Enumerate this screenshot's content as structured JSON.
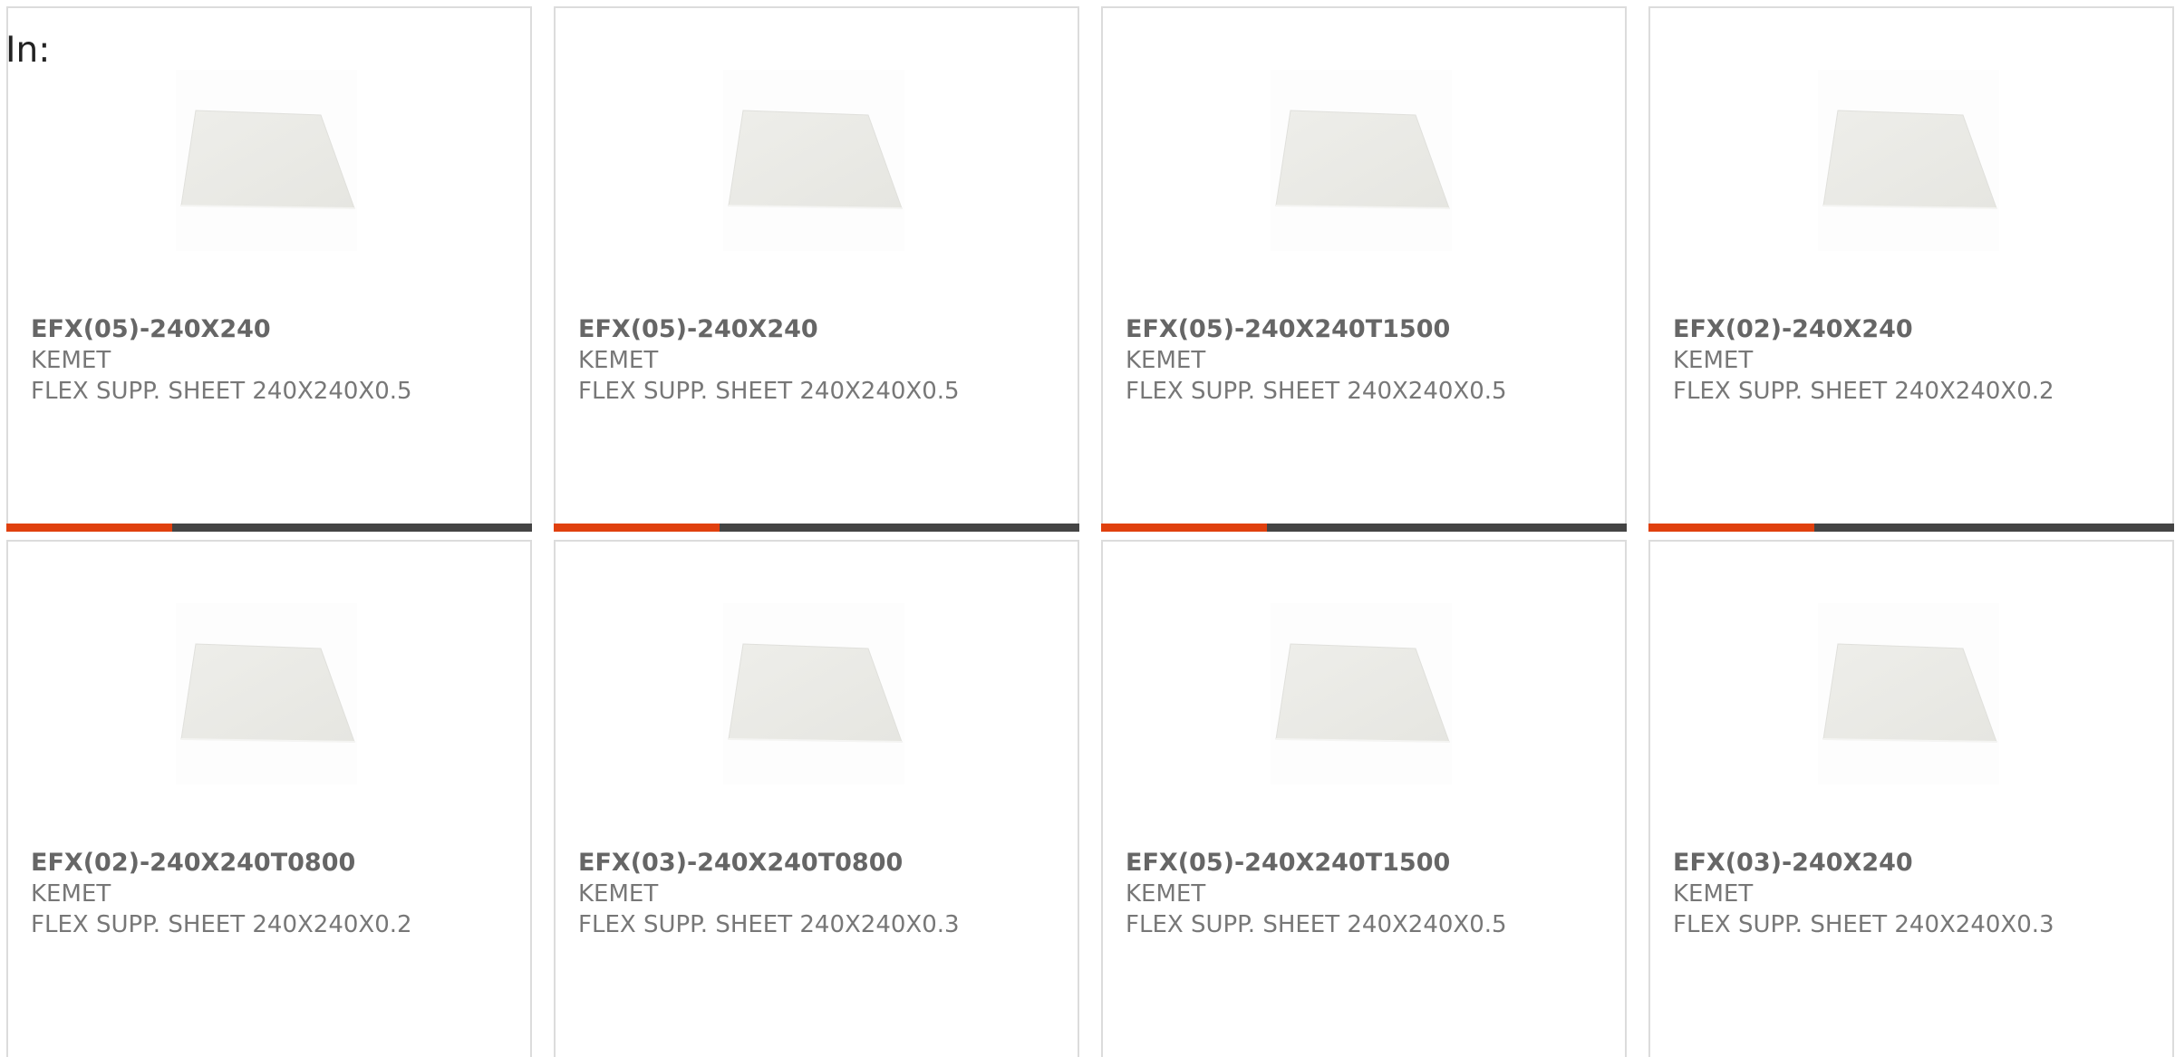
{
  "prefix_label": "In:",
  "colors": {
    "accent": "#e0400e",
    "bar_dark": "#444444",
    "card_border": "#dcdcdc",
    "text_primary": "#666666",
    "text_secondary": "#777777"
  },
  "products": [
    {
      "part_number": "EFX(05)-240X240",
      "manufacturer": "KEMET",
      "description": "FLEX SUPP. SHEET 240X240X0.5",
      "image_icon": "sheet-image"
    },
    {
      "part_number": "EFX(05)-240X240",
      "manufacturer": "KEMET",
      "description": "FLEX SUPP. SHEET 240X240X0.5",
      "image_icon": "sheet-image"
    },
    {
      "part_number": "EFX(05)-240X240T1500",
      "manufacturer": "KEMET",
      "description": "FLEX SUPP. SHEET 240X240X0.5",
      "image_icon": "sheet-image"
    },
    {
      "part_number": "EFX(02)-240X240",
      "manufacturer": "KEMET",
      "description": "FLEX SUPP. SHEET 240X240X0.2",
      "image_icon": "sheet-image"
    },
    {
      "part_number": "EFX(02)-240X240T0800",
      "manufacturer": "KEMET",
      "description": "FLEX SUPP. SHEET 240X240X0.2",
      "image_icon": "sheet-image"
    },
    {
      "part_number": "EFX(03)-240X240T0800",
      "manufacturer": "KEMET",
      "description": "FLEX SUPP. SHEET 240X240X0.3",
      "image_icon": "sheet-image"
    },
    {
      "part_number": "EFX(05)-240X240T1500",
      "manufacturer": "KEMET",
      "description": "FLEX SUPP. SHEET 240X240X0.5",
      "image_icon": "sheet-image"
    },
    {
      "part_number": "EFX(03)-240X240",
      "manufacturer": "KEMET",
      "description": "FLEX SUPP. SHEET 240X240X0.3",
      "image_icon": "sheet-image"
    }
  ]
}
